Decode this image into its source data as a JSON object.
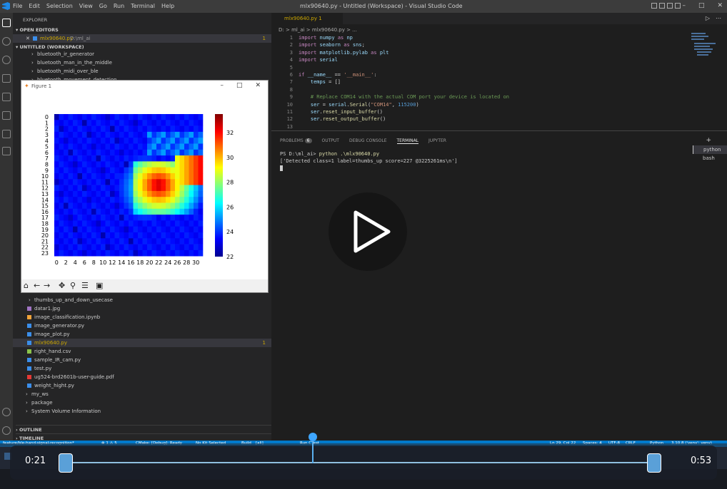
{
  "window": {
    "title": "mlx90640.py - Untitled (Workspace) - Visual Studio Code",
    "menu": [
      "File",
      "Edit",
      "Selection",
      "View",
      "Go",
      "Run",
      "Terminal",
      "Help"
    ]
  },
  "sidebar": {
    "header": "EXPLORER",
    "open_editors": "OPEN EDITORS",
    "open_file": "mlx90640.py",
    "open_file_path": "D:\\ml_ai",
    "open_file_count": "1",
    "workspace": "UNTITLED (WORKSPACE)",
    "top_items": [
      "bluetooth_ir_generator",
      "bluetooth_man_in_the_middle",
      "bluetooth_midi_over_ble",
      "bluetooth_movement_detection"
    ],
    "files": [
      {
        "name": "thumbs_up_and_down_usecase",
        "type": "folder"
      },
      {
        "name": "datar1.jpg",
        "type": "image"
      },
      {
        "name": "image_classification.ipynb",
        "type": "notebook"
      },
      {
        "name": "image_generator.py",
        "type": "py"
      },
      {
        "name": "image_plot.py",
        "type": "py"
      },
      {
        "name": "mlx90640.py",
        "type": "py",
        "count": "1"
      },
      {
        "name": "right_hand.csv",
        "type": "csv"
      },
      {
        "name": "sample_IR_cam.py",
        "type": "py"
      },
      {
        "name": "test.py",
        "type": "py"
      },
      {
        "name": "ug524-brd2601b-user-guide.pdf",
        "type": "pdf"
      },
      {
        "name": "weight_hight.py",
        "type": "py"
      }
    ],
    "folders": [
      "my_ws",
      "package",
      "System Volume Information"
    ],
    "outline": "OUTLINE",
    "timeline": "TIMELINE"
  },
  "editor": {
    "tab": "mlx90640.py 1",
    "breadcrumb": "D: > ml_ai > mlx90640.py > ...",
    "lines": [
      "1",
      "2",
      "3",
      "4",
      "5",
      "6",
      "7",
      "8",
      "9",
      "10",
      "11",
      "12",
      "13"
    ]
  },
  "panel": {
    "tabs": [
      "PROBLEMS",
      "OUTPUT",
      "DEBUG CONSOLE",
      "TERMINAL",
      "JUPYTER"
    ],
    "problems_count": "6",
    "prompt": "PS D:\\ml_ai> ",
    "command": "python .\\mlx90640.py",
    "output": "['Detected class=1 label=thumbs_up score=227 @3225261ms\\n']",
    "terminals": [
      "python",
      "bash"
    ]
  },
  "figure": {
    "title": "Figure 1"
  },
  "statusbar": {
    "left": "feature/ble-hand-signal-recognition*",
    "errors": "⊗ 1 ⚠ 5",
    "cmake": "CMake: [Debug]: Ready",
    "kit": "No Kit Selected",
    "build": "Build",
    "all": "[all]",
    "run": "Run CTest",
    "pos": "Ln 29, Col 22",
    "spaces": "Spaces: 4",
    "enc": "UTF-8",
    "eol": "CRLF",
    "lang": "Python",
    "ver": "3.10.8 ('venv': venv)"
  },
  "video": {
    "start": "0:21",
    "end": "0:53"
  },
  "chart_data": {
    "type": "heatmap",
    "x_ticks": [
      "0",
      "2",
      "4",
      "6",
      "8",
      "10",
      "12",
      "14",
      "16",
      "18",
      "20",
      "22",
      "24",
      "26",
      "28",
      "30"
    ],
    "y_ticks": [
      "0",
      "1",
      "2",
      "3",
      "4",
      "5",
      "6",
      "7",
      "8",
      "9",
      "10",
      "11",
      "12",
      "13",
      "14",
      "15",
      "16",
      "17",
      "18",
      "19",
      "20",
      "21",
      "22",
      "23"
    ],
    "colorbar_ticks": [
      "22",
      "24",
      "26",
      "28",
      "30",
      "32"
    ],
    "colorbar_range": [
      22,
      33.5
    ],
    "colormap": "jet",
    "hot_region": "rows 8-16, cols 17-31, peak ~33"
  }
}
